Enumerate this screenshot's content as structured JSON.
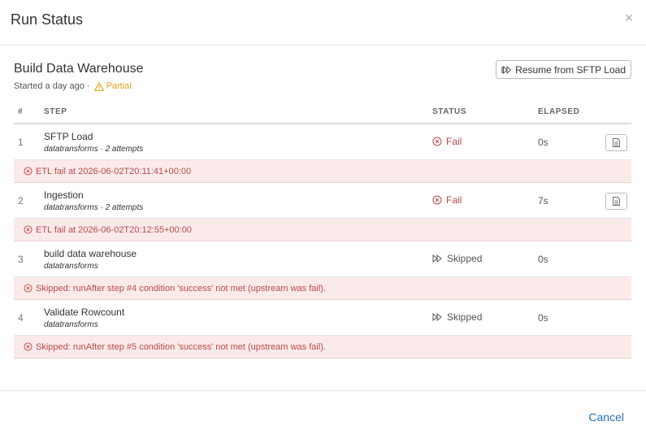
{
  "modal": {
    "title": "Run Status",
    "close_label": "×"
  },
  "run": {
    "name": "Build Data Warehouse",
    "started": "Started a day ago ·",
    "state": "Partial",
    "resume_label": "Resume from SFTP Load"
  },
  "table": {
    "headers": {
      "num": "#",
      "step": "STEP",
      "status": "STATUS",
      "elapsed": "ELAPSED"
    },
    "rows": [
      {
        "num": "1",
        "name": "SFTP Load",
        "sub": "datatransforms · 2 attempts",
        "status": "Fail",
        "elapsed": "0s",
        "error": "ETL fail at 2026-06-02T20:11:41+00:00"
      },
      {
        "num": "2",
        "name": "Ingestion",
        "sub": "datatransforms · 2 attempts",
        "status": "Fail",
        "elapsed": "7s",
        "error": "ETL fail at 2026-06-02T20:12:55+00:00"
      },
      {
        "num": "3",
        "name": "build data warehouse",
        "sub": "datatransforms",
        "status": "Skipped",
        "elapsed": "0s",
        "error": "Skipped: runAfter step #4 condition 'success' not met (upstream was fail)."
      },
      {
        "num": "4",
        "name": "Validate Rowcount",
        "sub": "datatransforms",
        "status": "Skipped",
        "elapsed": "0s",
        "error": "Skipped: runAfter step #5 condition 'success' not met (upstream was fail)."
      }
    ]
  },
  "footer": {
    "cancel_label": "Cancel"
  },
  "colors": {
    "fail": "#b94a48",
    "warning": "#e8a317",
    "link": "#2a6ebb",
    "error_bg": "#fbeaea"
  },
  "icons": {
    "close": "close-icon",
    "warning": "warning-icon",
    "fail": "x-circle-icon",
    "skipped": "fast-forward-icon",
    "log": "document-icon",
    "resume": "resume-icon"
  }
}
